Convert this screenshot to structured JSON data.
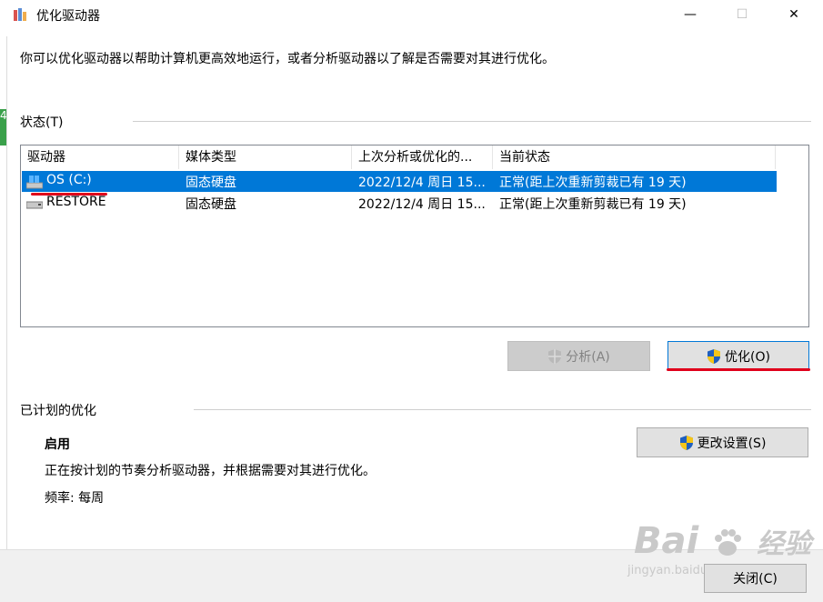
{
  "window": {
    "title": "优化驱动器",
    "minimize_glyph": "—",
    "maximize_glyph": "☐",
    "close_glyph": "✕",
    "edge_fragment": "4"
  },
  "description": "你可以优化驱动器以帮助计算机更高效地运行，或者分析驱动器以了解是否需要对其进行优化。",
  "status_section": {
    "label": "状态(T)",
    "columns": [
      "驱动器",
      "媒体类型",
      "上次分析或优化的...",
      "当前状态"
    ],
    "drives": [
      {
        "name": "OS (C:)",
        "media": "固态硬盘",
        "last_run": "2022/12/4 周日 15...",
        "state": "正常(距上次重新剪裁已有 19 天)",
        "selected": true,
        "icon": "os-drive-icon"
      },
      {
        "name": "RESTORE",
        "media": "固态硬盘",
        "last_run": "2022/12/4 周日 15...",
        "state": "正常(距上次重新剪裁已有 19 天)",
        "selected": false,
        "icon": "drive-icon"
      }
    ]
  },
  "buttons": {
    "analyze": "分析(A)",
    "optimize": "优化(O)",
    "change_settings": "更改设置(S)",
    "close": "关闭(C)"
  },
  "scheduled_section": {
    "label": "已计划的优化",
    "status": "启用",
    "detail": "正在按计划的节奏分析驱动器，并根据需要对其进行优化。",
    "frequency": "频率: 每周"
  },
  "watermark": {
    "brand_left": "Bai",
    "brand_right": "经验",
    "url": "jingyan.baidu.com"
  },
  "colors": {
    "selection": "#0078d7",
    "annotation_red": "#e0001b",
    "shield_blue": "#1f5fbf",
    "shield_yellow": "#f5c518"
  }
}
